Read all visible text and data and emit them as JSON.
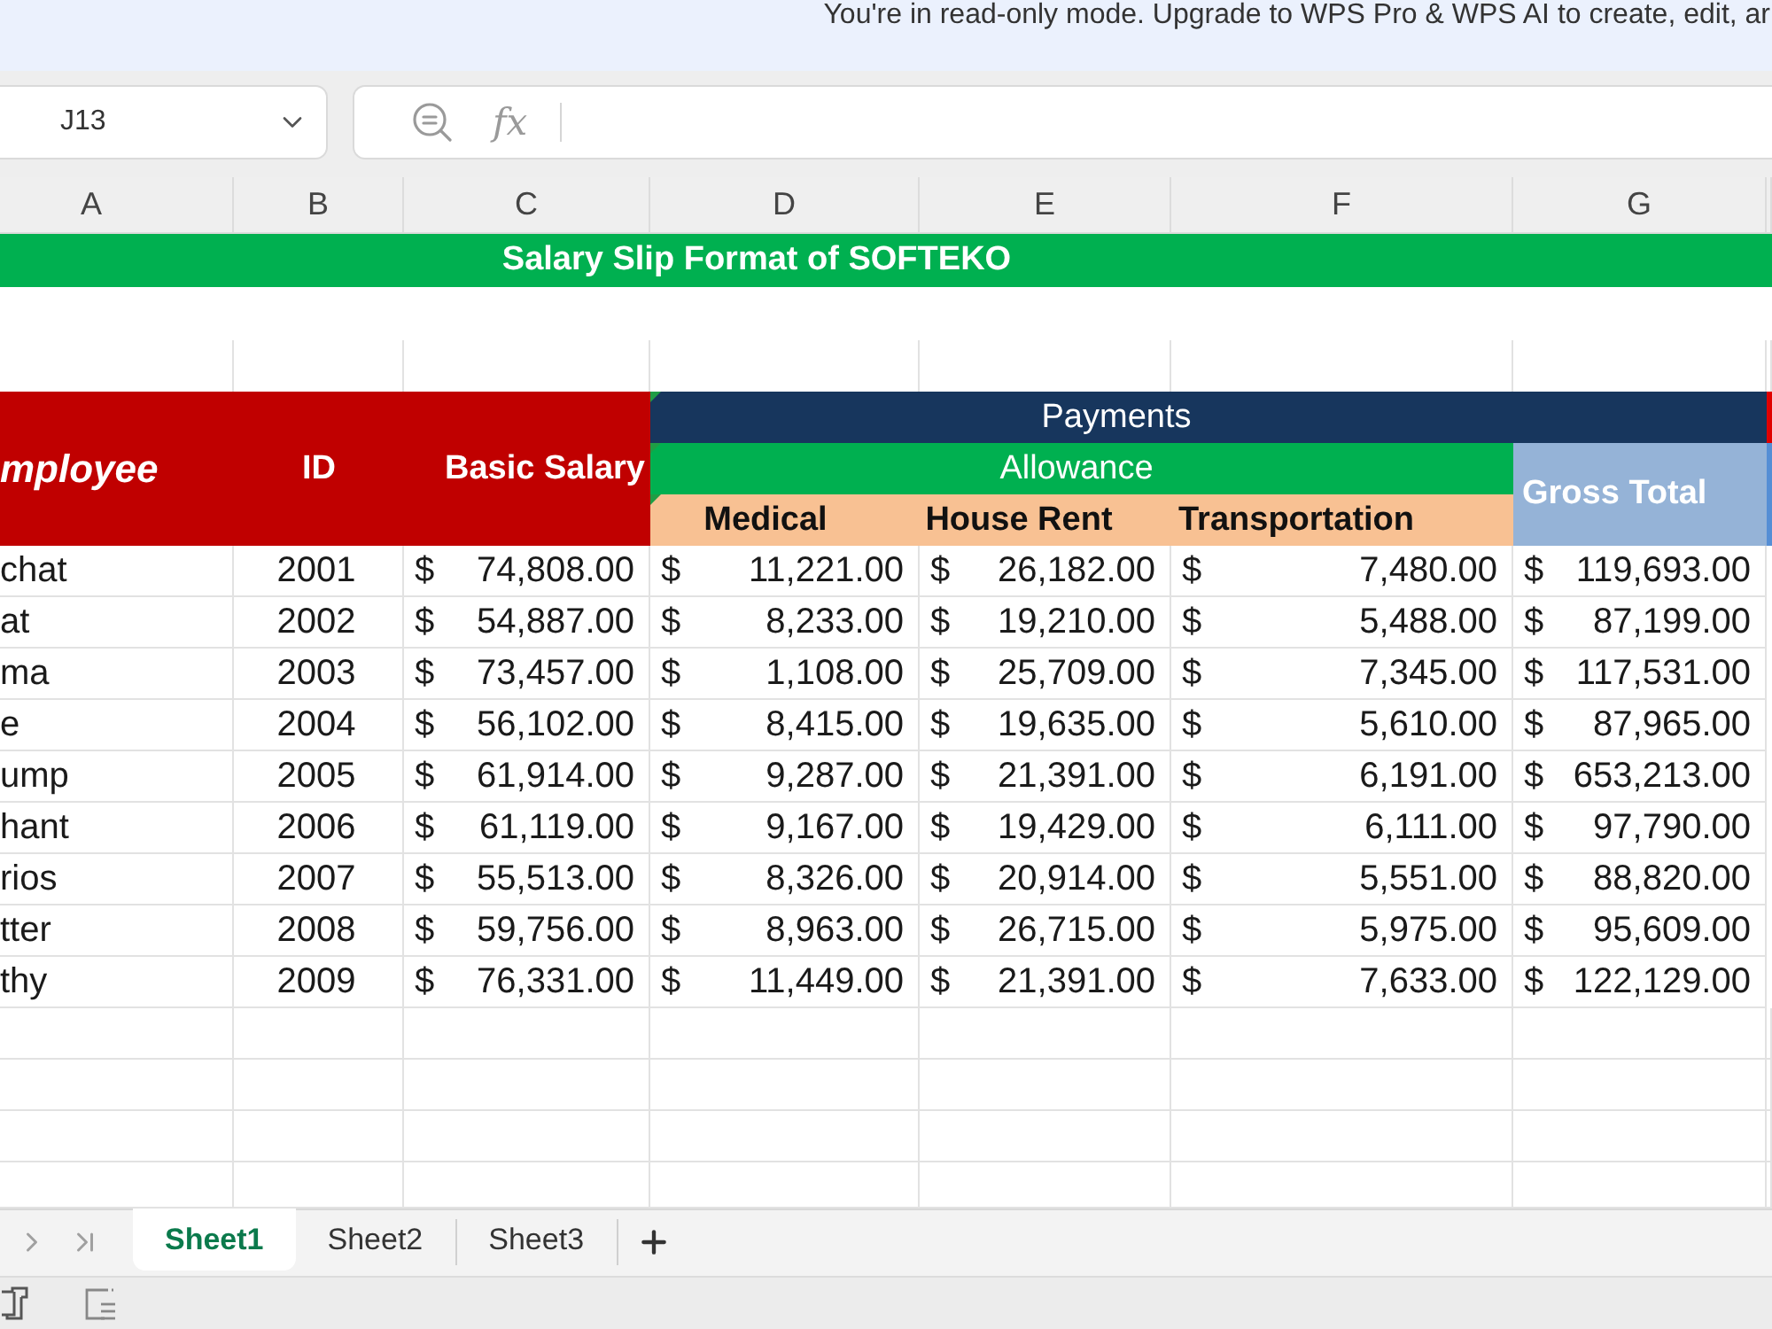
{
  "banner": {
    "text": "You're in read-only mode. Upgrade to WPS Pro & WPS AI to create, edit, ar"
  },
  "formula_bar": {
    "cell_reference": "J13",
    "function_symbol": "fx"
  },
  "column_headers": [
    "A",
    "B",
    "C",
    "D",
    "E",
    "F",
    "G"
  ],
  "sheet": {
    "title": "Salary Slip Format of SOFTEKO",
    "header": {
      "employee": "mployee",
      "id": "ID",
      "basic_salary": "Basic Salary",
      "payments": "Payments",
      "allowance": "Allowance",
      "gross_total": "Gross Total",
      "medical": "Medical",
      "house_rent": "House Rent",
      "transportation": "Transportation"
    },
    "rows": [
      {
        "employee": "chat",
        "id": "2001",
        "amounts": [
          {
            "currency": "$",
            "value": "74,808.00"
          },
          {
            "currency": "$",
            "value": "11,221.00"
          },
          {
            "currency": "$",
            "value": "26,182.00"
          },
          {
            "currency": "$",
            "value": "7,480.00"
          },
          {
            "currency": "$",
            "value": "119,693.00"
          }
        ]
      },
      {
        "employee": "at",
        "id": "2002",
        "amounts": [
          {
            "currency": "$",
            "value": "54,887.00"
          },
          {
            "currency": "$",
            "value": "8,233.00"
          },
          {
            "currency": "$",
            "value": "19,210.00"
          },
          {
            "currency": "$",
            "value": "5,488.00"
          },
          {
            "currency": "$",
            "value": "87,199.00"
          }
        ]
      },
      {
        "employee": "ma",
        "id": "2003",
        "amounts": [
          {
            "currency": "$",
            "value": "73,457.00"
          },
          {
            "currency": "$",
            "value": "1,108.00"
          },
          {
            "currency": "$",
            "value": "25,709.00"
          },
          {
            "currency": "$",
            "value": "7,345.00"
          },
          {
            "currency": "$",
            "value": "117,531.00"
          }
        ]
      },
      {
        "employee": "e",
        "id": "2004",
        "amounts": [
          {
            "currency": "$",
            "value": "56,102.00"
          },
          {
            "currency": "$",
            "value": "8,415.00"
          },
          {
            "currency": "$",
            "value": "19,635.00"
          },
          {
            "currency": "$",
            "value": "5,610.00"
          },
          {
            "currency": "$",
            "value": "87,965.00"
          }
        ]
      },
      {
        "employee": "ump",
        "id": "2005",
        "amounts": [
          {
            "currency": "$",
            "value": "61,914.00"
          },
          {
            "currency": "$",
            "value": "9,287.00"
          },
          {
            "currency": "$",
            "value": "21,391.00"
          },
          {
            "currency": "$",
            "value": "6,191.00"
          },
          {
            "currency": "$",
            "value": "653,213.00"
          }
        ]
      },
      {
        "employee": "hant",
        "id": "2006",
        "amounts": [
          {
            "currency": "$",
            "value": "61,119.00"
          },
          {
            "currency": "$",
            "value": "9,167.00"
          },
          {
            "currency": "$",
            "value": "19,429.00"
          },
          {
            "currency": "$",
            "value": "6,111.00"
          },
          {
            "currency": "$",
            "value": "97,790.00"
          }
        ]
      },
      {
        "employee": "rios",
        "id": "2007",
        "amounts": [
          {
            "currency": "$",
            "value": "55,513.00"
          },
          {
            "currency": "$",
            "value": "8,326.00"
          },
          {
            "currency": "$",
            "value": "20,914.00"
          },
          {
            "currency": "$",
            "value": "5,551.00"
          },
          {
            "currency": "$",
            "value": "88,820.00"
          }
        ]
      },
      {
        "employee": "tter",
        "id": "2008",
        "amounts": [
          {
            "currency": "$",
            "value": "59,756.00"
          },
          {
            "currency": "$",
            "value": "8,963.00"
          },
          {
            "currency": "$",
            "value": "26,715.00"
          },
          {
            "currency": "$",
            "value": "5,975.00"
          },
          {
            "currency": "$",
            "value": "95,609.00"
          }
        ]
      },
      {
        "employee": "thy",
        "id": "2009",
        "amounts": [
          {
            "currency": "$",
            "value": "76,331.00"
          },
          {
            "currency": "$",
            "value": "11,449.00"
          },
          {
            "currency": "$",
            "value": "21,391.00"
          },
          {
            "currency": "$",
            "value": "7,633.00"
          },
          {
            "currency": "$",
            "value": "122,129.00"
          }
        ]
      }
    ]
  },
  "sheet_tabs": [
    {
      "label": "Sheet1",
      "selected": true
    },
    {
      "label": "Sheet2",
      "selected": false
    },
    {
      "label": "Sheet3",
      "selected": false
    }
  ]
}
